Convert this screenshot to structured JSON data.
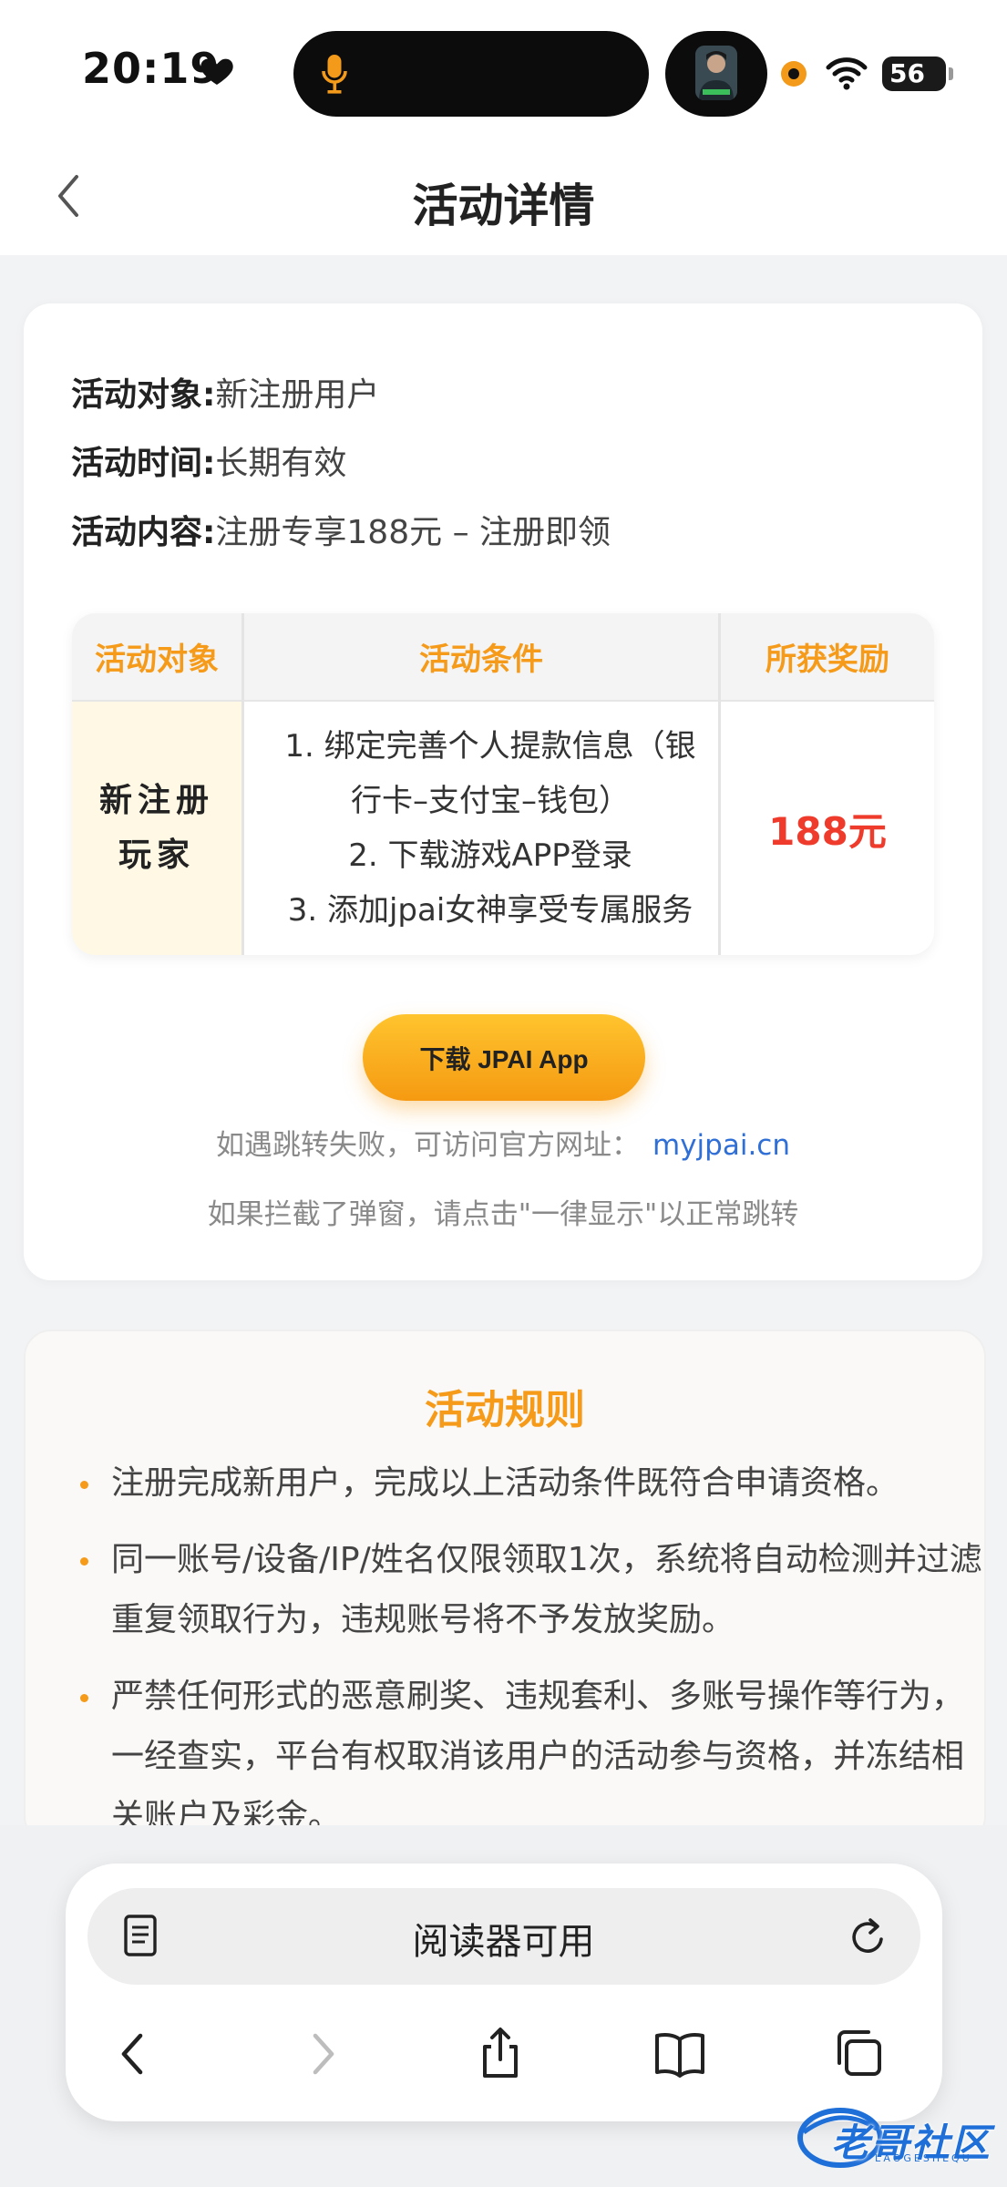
{
  "status_bar": {
    "time": "20:19",
    "battery": "56"
  },
  "header": {
    "title": "活动详情"
  },
  "activity_info": [
    {
      "label": "活动对象:",
      "value": "新注册用户"
    },
    {
      "label": "活动时间:",
      "value": "长期有效"
    },
    {
      "label": "活动内容:",
      "value": "注册专享188元 – 注册即领"
    }
  ],
  "table": {
    "headers": [
      "活动对象",
      "活动条件",
      "所获奖励"
    ],
    "row": {
      "target_line1": "新注册",
      "target_line2": "玩家",
      "conditions": [
        "1. 绑定完善个人提款信息（银",
        "行卡–支付宝–钱包）",
        "2. 下载游戏APP登录",
        "3. 添加jpai女神享受专属服务"
      ],
      "reward": "188元"
    }
  },
  "download_button": "下载 JPAI App",
  "tips": {
    "line1_prefix": "如遇跳转失败，可访问官方网址：",
    "official_url": "myjpai.cn",
    "line2": "如果拦截了弹窗，请点击\"一律显示\"以正常跳转"
  },
  "rules": {
    "title": "活动规则",
    "items": [
      "注册完成新用户，完成以上活动条件既符合申请资格。",
      "同一账号/设备/IP/姓名仅限领取1次，系统将自动检测并过滤重复领取行为，违规账号将不予发放奖励。",
      "严禁任何形式的恶意刷奖、违规套利、多账号操作等行为，一经查实，平台有权取消该用户的活动参与资格，并冻结相关账户及彩金。"
    ]
  },
  "browser": {
    "reader_text": "阅读器可用"
  },
  "watermark": {
    "text": "老哥社区",
    "sub": "LAOGESHEQU"
  },
  "colors": {
    "accent": "#f59a19",
    "reward": "#ee3b2c",
    "link": "#2f6fd6",
    "target_cell_bg": "#fef8e5"
  }
}
